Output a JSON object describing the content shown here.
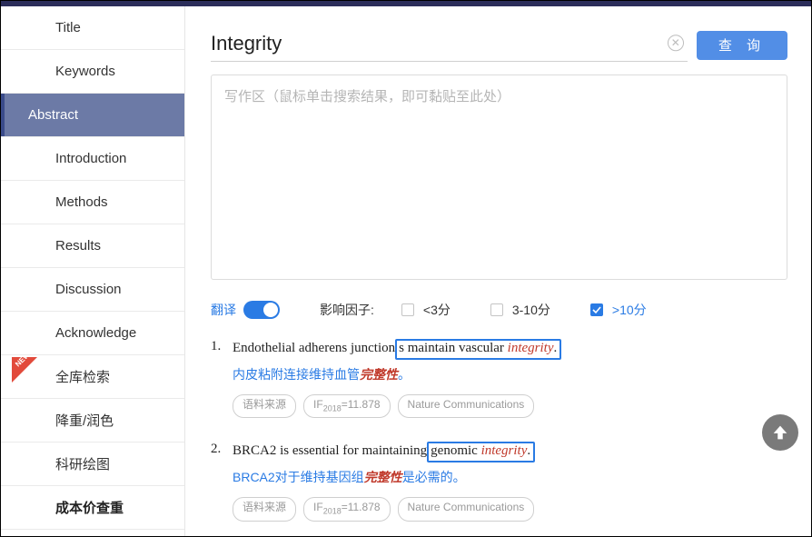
{
  "sidebar": {
    "items": [
      {
        "label": "Title"
      },
      {
        "label": "Keywords"
      },
      {
        "label": "Abstract",
        "active": true
      },
      {
        "label": "Introduction"
      },
      {
        "label": "Methods"
      },
      {
        "label": "Results"
      },
      {
        "label": "Discussion"
      },
      {
        "label": "Acknowledge"
      },
      {
        "label": "全库检索",
        "new": true
      },
      {
        "label": "降重/润色"
      },
      {
        "label": "科研绘图"
      },
      {
        "label": "成本价查重",
        "bold": true
      }
    ]
  },
  "search": {
    "value": "Integrity",
    "button": "查 询",
    "clear_icon": "✕"
  },
  "writing_placeholder": "写作区（鼠标单击搜索结果，即可黏贴至此处）",
  "filters": {
    "translate_label": "翻译",
    "if_label": "影响因子:",
    "options": [
      "<3分",
      "3-10分",
      ">10分"
    ],
    "checked": 2
  },
  "results": [
    {
      "num": "1.",
      "en_prefix": "Endothelial adherens junction",
      "en_box": "s maintain vascular integrity.",
      "en_keyword": "integrity",
      "cn_pre": "内皮粘附连接维持血管",
      "cn_kw": "完整性",
      "cn_post": "。",
      "pills": [
        "语料来源",
        "IF 2018 = 11.878",
        "Nature Communications"
      ]
    },
    {
      "num": "2.",
      "en_prefix": "BRCA2 is essential for maintaining",
      "en_box": " genomic integrity.",
      "en_keyword": "integrity",
      "cn_pre": "BRCA2对于维持基因组",
      "cn_kw": "完整性",
      "cn_post": "是必需的。",
      "pills": [
        "语料来源",
        "IF 2018 = 11.878",
        "Nature Communications"
      ]
    }
  ]
}
